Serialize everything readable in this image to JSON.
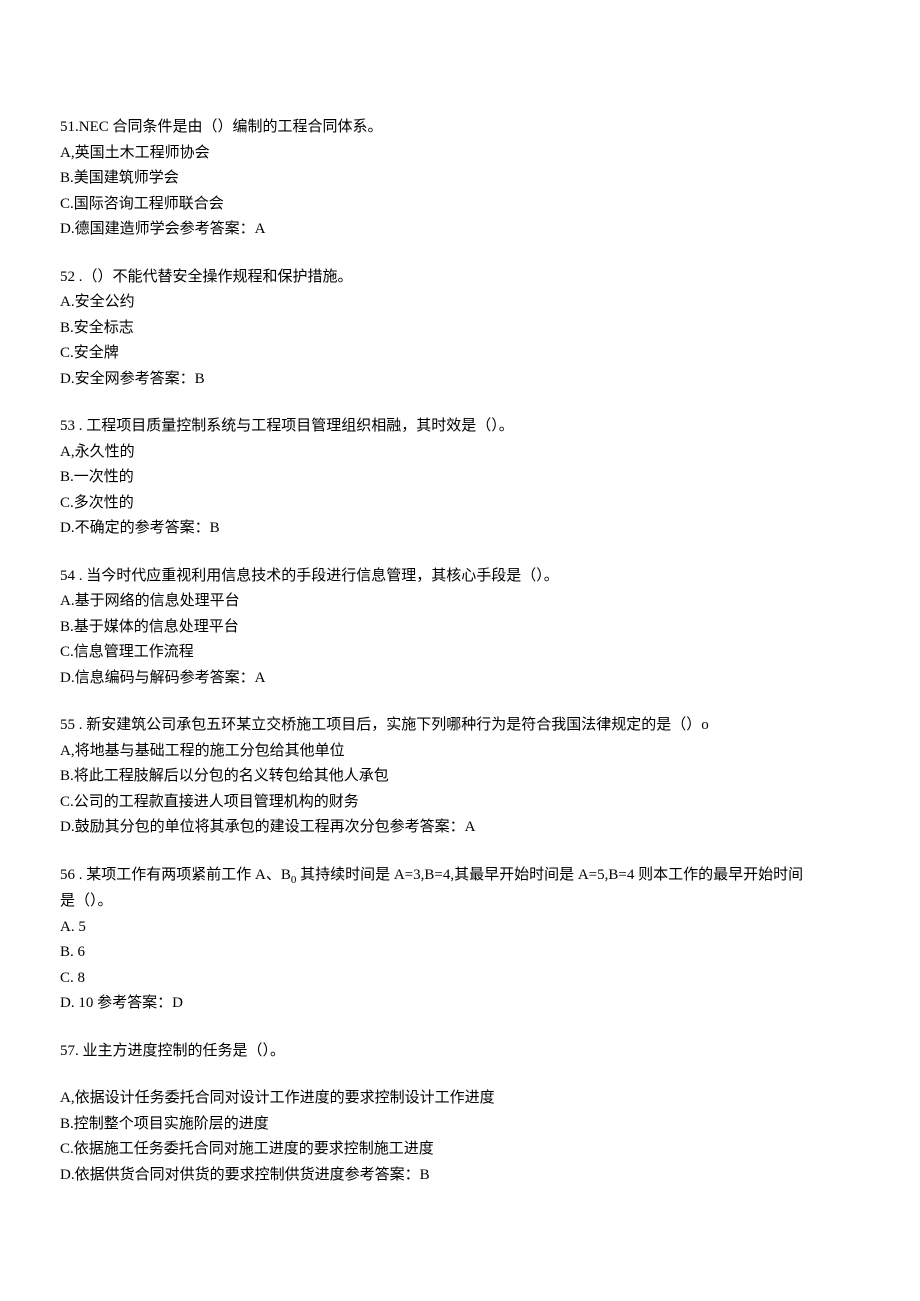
{
  "questions": [
    {
      "id": "q51",
      "stem": "51.NEC 合同条件是由（）编制的工程合同体系。",
      "options": [
        "A,英国土木工程师协会",
        "B.美国建筑师学会",
        "C.国际咨询工程师联合会",
        "D.德国建造师学会参考答案：A"
      ]
    },
    {
      "id": "q52",
      "stem": "52  .（）不能代替安全操作规程和保护措施。",
      "options": [
        "A.安全公约",
        "B.安全标志",
        "C.安全牌",
        "D.安全网参考答案：B"
      ]
    },
    {
      "id": "q53",
      "stem": "53  . 工程项目质量控制系统与工程项目管理组织相融，其时效是（）。",
      "options": [
        "A,永久性的",
        "B.一次性的",
        "C.多次性的",
        "D.不确定的参考答案：B"
      ]
    },
    {
      "id": "q54",
      "stem": "54  . 当今时代应重视利用信息技术的手段进行信息管理，其核心手段是（）。",
      "options": [
        "A.基于网络的信息处理平台",
        "B.基于媒体的信息处理平台",
        "C.信息管理工作流程",
        "D.信息编码与解码参考答案：A"
      ]
    },
    {
      "id": "q55",
      "stem": "55  . 新安建筑公司承包五环某立交桥施工项目后，实施下列哪种行为是符合我国法律规定的是（）o",
      "options": [
        "A,将地基与基础工程的施工分包给其他单位",
        "B.将此工程肢解后以分包的名义转包给其他人承包",
        "C.公司的工程款直接进人项目管理机构的财务",
        "D.鼓励其分包的单位将其承包的建设工程再次分包参考答案：A"
      ]
    },
    {
      "id": "q56",
      "stem_pre": "56  . 某项工作有两项紧前工作 A、B",
      "stem_sub": "0",
      "stem_post": " 其持续时间是 A=3,B=4,其最早开始时间是 A=5,B=4 则本工作的最早开始时间",
      "stem_line2": "是（）。",
      "options": [
        "A.   5",
        "B.   6",
        "C.   8",
        "D.   10 参考答案：D"
      ]
    },
    {
      "id": "q57",
      "stem": "57. 业主方进度控制的任务是（）。",
      "options": [
        "A,依据设计任务委托合同对设计工作进度的要求控制设计工作进度",
        "B.控制整个项目实施阶层的进度",
        "C.依据施工任务委托合同对施工进度的要求控制施工进度",
        "D.依据供货合同对供货的要求控制供货进度参考答案：B"
      ]
    }
  ]
}
